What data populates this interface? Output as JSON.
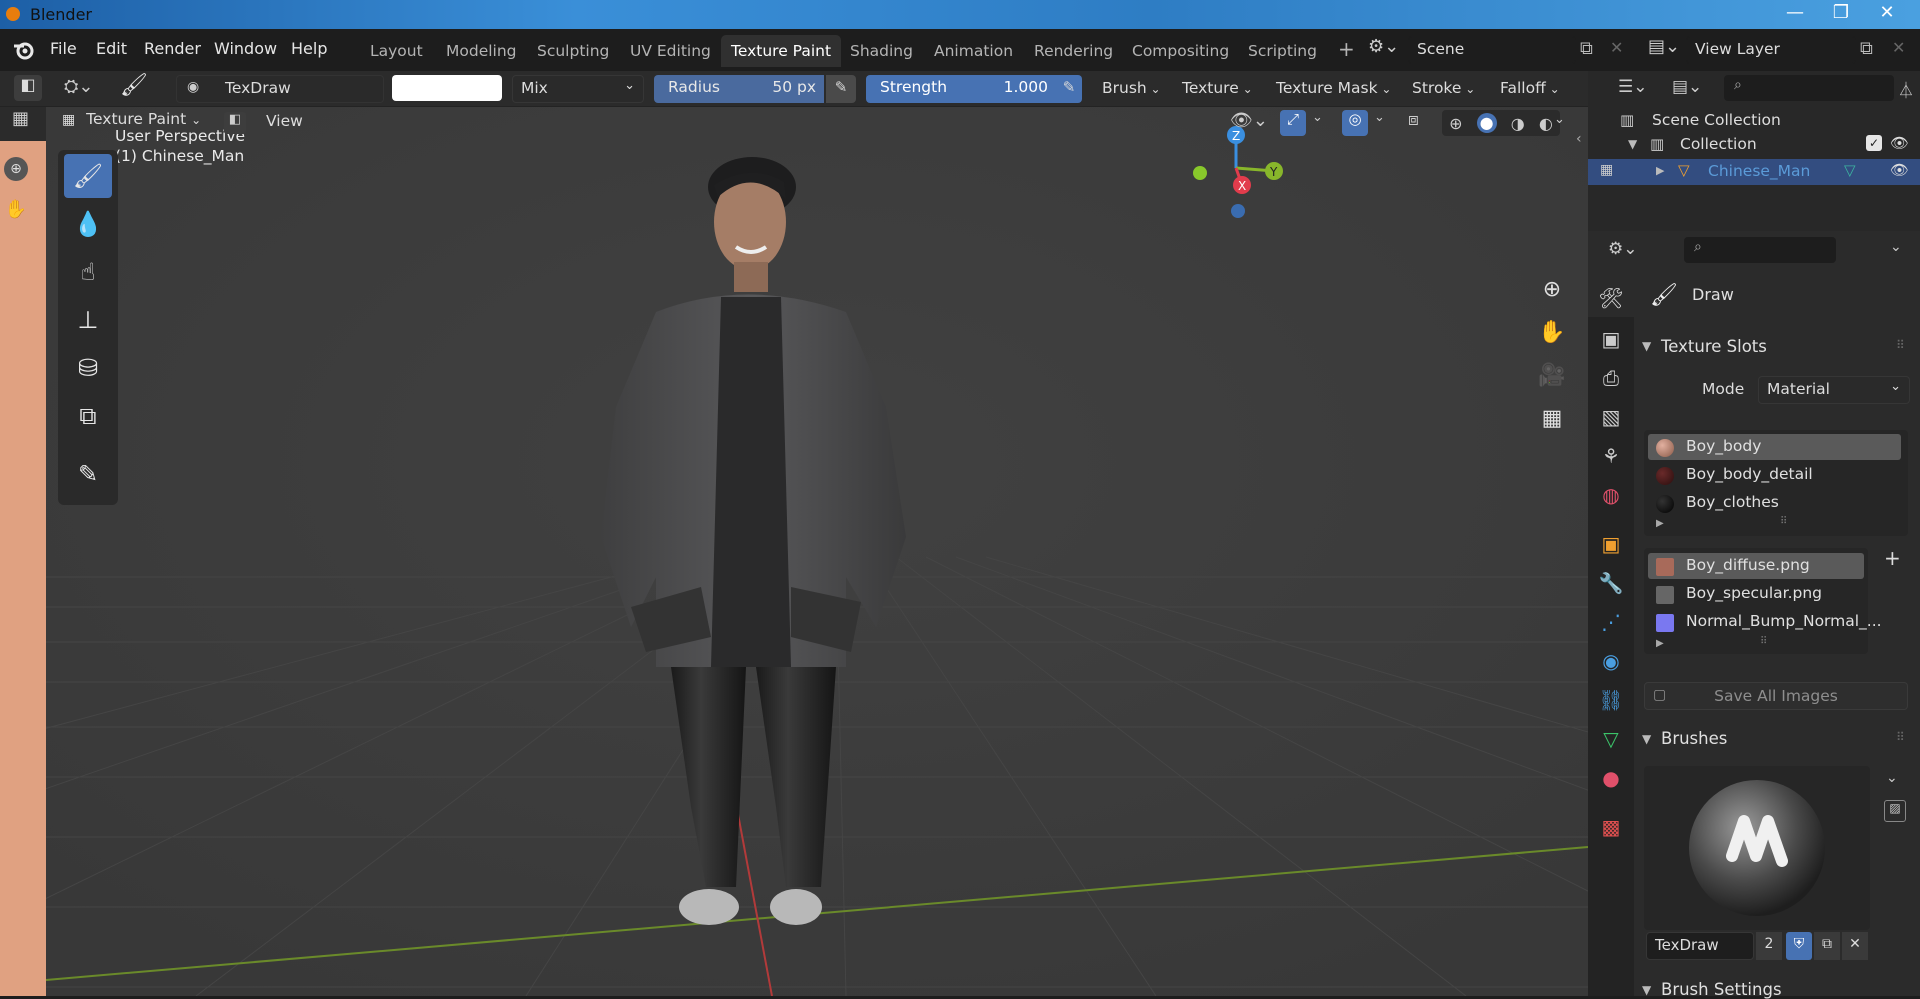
{
  "window": {
    "title": "Blender",
    "minimize": "—",
    "restore": "❐",
    "close": "✕"
  },
  "menu": {
    "items": [
      "File",
      "Edit",
      "Render",
      "Window",
      "Help"
    ]
  },
  "workspaces": {
    "tabs": [
      "Layout",
      "Modeling",
      "Sculpting",
      "UV Editing",
      "Texture Paint",
      "Shading",
      "Animation",
      "Rendering",
      "Compositing",
      "Scripting"
    ],
    "active": "Texture Paint",
    "add": "+"
  },
  "scene": {
    "name": "Scene"
  },
  "viewlayer": {
    "name": "View Layer"
  },
  "tool_header": {
    "brush_name": "TexDraw",
    "blend": "Mix",
    "radius_label": "Radius",
    "radius_value": "50 px",
    "strength_label": "Strength",
    "strength_value": "1.000",
    "menus": [
      "Brush",
      "Texture",
      "Texture Mask",
      "Stroke",
      "Falloff"
    ]
  },
  "viewport_header": {
    "mode": "Texture Paint",
    "view": "View"
  },
  "viewport": {
    "perspective": "User Perspective",
    "object": "(1) Chinese_Man"
  },
  "gizmo": {
    "z": "Z",
    "y": "Y",
    "x": "X"
  },
  "outliner": {
    "scene_collection": "Scene Collection",
    "collection": "Collection",
    "object": "Chinese_Man"
  },
  "properties": {
    "tool_name": "Draw",
    "texture_slots": {
      "title": "Texture Slots",
      "mode_label": "Mode",
      "mode_value": "Material",
      "materials": [
        "Boy_body",
        "Boy_body_detail",
        "Boy_clothes"
      ],
      "images": [
        "Boy_diffuse.png",
        "Boy_specular.png",
        "Normal_Bump_Normal_..."
      ],
      "save_all": "Save All Images"
    },
    "brushes": {
      "title": "Brushes",
      "name": "TexDraw",
      "users": "2"
    },
    "brush_settings": {
      "title": "Brush Settings"
    }
  },
  "colors": {
    "accent": "#4772b3",
    "active_object": "#5b9bd8",
    "x_axis": "#e23c4c",
    "y_axis": "#88b62b",
    "z_axis": "#3a8fe0"
  }
}
